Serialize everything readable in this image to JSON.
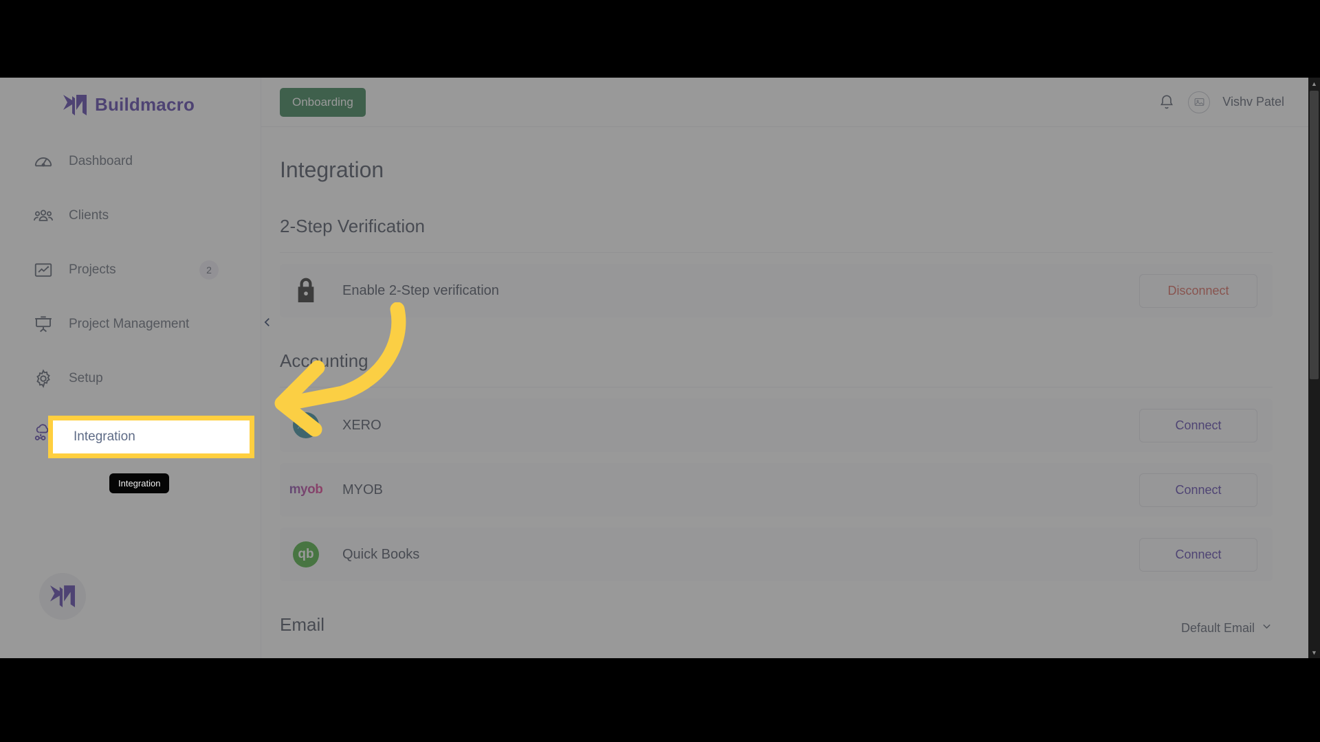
{
  "brand": {
    "name": "Buildmacro"
  },
  "sidebar": {
    "items": [
      {
        "label": "Dashboard",
        "icon": "speedometer-icon",
        "badge": null
      },
      {
        "label": "Clients",
        "icon": "people-group-icon",
        "badge": null
      },
      {
        "label": "Projects",
        "icon": "chart-box-icon",
        "badge": "2"
      },
      {
        "label": "Project Management",
        "icon": "presentation-board-icon",
        "badge": null
      },
      {
        "label": "Setup",
        "icon": "gear-icon",
        "badge": null
      },
      {
        "label": "Integration",
        "icon": "integration-cloud-icon",
        "badge": null
      }
    ],
    "highlighted_item": "Integration",
    "tooltip": "Integration",
    "collapse_icon": "chevron-left-icon"
  },
  "topbar": {
    "onboarding_label": "Onboarding",
    "notification_icon": "bell-icon",
    "avatar_icon": "image-placeholder-icon",
    "user_name": "Vishv Patel"
  },
  "main": {
    "page_title": "Integration",
    "sections": [
      {
        "title": "2-Step Verification",
        "rows": [
          {
            "logo": "lock-icon",
            "label": "Enable 2-Step verification",
            "action": "Disconnect",
            "action_kind": "disconnect"
          }
        ]
      },
      {
        "title": "Accounting",
        "rows": [
          {
            "logo": "xero-logo",
            "logo_text": "xero",
            "label": "XERO",
            "action": "Connect",
            "action_kind": "connect"
          },
          {
            "logo": "myob-logo",
            "logo_text": "myob",
            "label": "MYOB",
            "action": "Connect",
            "action_kind": "connect"
          },
          {
            "logo": "quickbooks-logo",
            "logo_text": "qb",
            "label": "Quick Books",
            "action": "Connect",
            "action_kind": "connect"
          }
        ]
      }
    ],
    "email_section": {
      "title": "Email",
      "dropdown_label": "Default Email",
      "dropdown_icon": "chevron-down-icon"
    }
  },
  "colors": {
    "brand_purple": "#3a1d9c",
    "highlight_yellow": "#ffcf3f",
    "onboarding_green": "#136a36",
    "disconnect_red": "#d24b3e",
    "xero_teal": "#13788d",
    "quickbooks_green": "#2ca01c"
  },
  "scrollbar": {
    "up_icon": "triangle-up-icon",
    "down_icon": "triangle-down-icon"
  }
}
